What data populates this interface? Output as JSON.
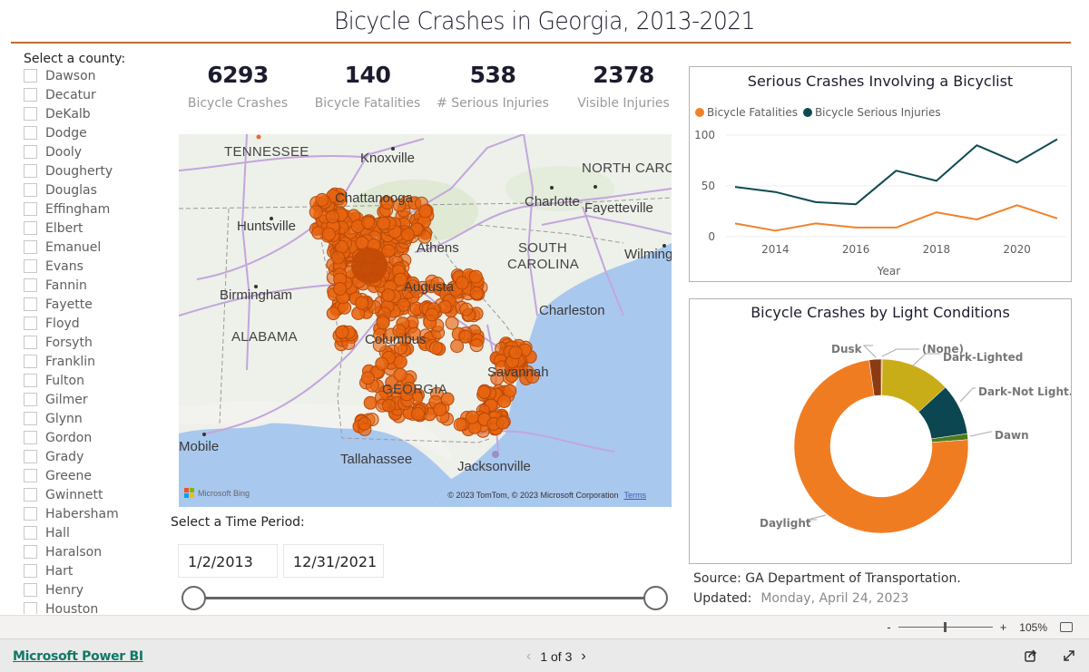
{
  "report": {
    "title": "Bicycle Crashes in Georgia, 2013-2021",
    "accent_color": "#c26a35"
  },
  "county_slicer": {
    "label": "Select a county:",
    "items": [
      "Dawson",
      "Decatur",
      "DeKalb",
      "Dodge",
      "Dooly",
      "Dougherty",
      "Douglas",
      "Effingham",
      "Elbert",
      "Emanuel",
      "Evans",
      "Fannin",
      "Fayette",
      "Floyd",
      "Forsyth",
      "Franklin",
      "Fulton",
      "Gilmer",
      "Glynn",
      "Gordon",
      "Grady",
      "Greene",
      "Gwinnett",
      "Habersham",
      "Hall",
      "Haralson",
      "Hart",
      "Henry",
      "Houston"
    ]
  },
  "kpis": [
    {
      "value": "6293",
      "label": "Bicycle Crashes"
    },
    {
      "value": "140",
      "label": "Bicycle Fatalities"
    },
    {
      "value": "538",
      "label": "# Serious Injuries"
    },
    {
      "value": "2378",
      "label": "Visible Injuries"
    }
  ],
  "map": {
    "labels": {
      "tennessee": "TENNESSEE",
      "knoxville": "Knoxville",
      "north_carolina": "NORTH CAROLINA",
      "chattanooga": "Chattanooga",
      "charlotte": "Charlotte",
      "fayetteville": "Fayetteville",
      "huntsville": "Huntsville",
      "athens": "Athens",
      "south_carolina_1": "SOUTH",
      "south_carolina_2": "CAROLINA",
      "wilmington": "Wilmington",
      "birmingham": "Birmingham",
      "augusta": "Augusta",
      "charleston": "Charleston",
      "alabama": "ALABAMA",
      "columbus": "Columbus",
      "savannah": "Savannah",
      "georgia": "GEORGIA",
      "mobile": "Mobile",
      "tallahassee": "Tallahassee",
      "jacksonville": "Jacksonville"
    },
    "bing_label": "Microsoft Bing",
    "attribution": "© 2023 TomTom, © 2023 Microsoft Corporation",
    "terms_label": "Terms",
    "marker_color": "#e8640f"
  },
  "time_slicer": {
    "label": "Select a Time Period:",
    "start": "1/2/2013",
    "end": "12/31/2021"
  },
  "chart_data": [
    {
      "type": "line",
      "title": "Serious Crashes Involving a Bicyclist",
      "xlabel": "Year",
      "ylabel": "",
      "x": [
        2013,
        2014,
        2015,
        2016,
        2017,
        2018,
        2019,
        2020,
        2021
      ],
      "x_ticks": [
        "2014",
        "2016",
        "2018",
        "2020"
      ],
      "y_ticks": [
        "0",
        "50",
        "100"
      ],
      "ylim": [
        0,
        100
      ],
      "grid": true,
      "legend": "top-left",
      "series": [
        {
          "name": "Bicycle Fatalities",
          "color": "#f0822a",
          "values": [
            13,
            6,
            13,
            9,
            9,
            24,
            17,
            31,
            18
          ]
        },
        {
          "name": "Bicycle Serious Injuries",
          "color": "#0f4a52",
          "values": [
            49,
            44,
            34,
            32,
            65,
            55,
            90,
            73,
            96
          ]
        }
      ]
    },
    {
      "type": "pie",
      "subtype": "donut",
      "title": "Bicycle Crashes by Light Conditions",
      "categories": [
        "(None)",
        "Dark-Lighted",
        "Dark-Not Lighted",
        "Dawn",
        "Daylight",
        "Dusk"
      ],
      "display_labels": [
        "(None)",
        "Dark-Lighted",
        "Dark-Not Light...",
        "Dawn",
        "Daylight",
        "Dusk"
      ],
      "values": [
        0.2,
        13.0,
        9.5,
        1.1,
        74.0,
        2.2
      ],
      "unit": "percent (estimated)",
      "colors": [
        "#7a7a7a",
        "#c9ad18",
        "#0c4650",
        "#4f7a1c",
        "#f07c22",
        "#8b3a11"
      ]
    }
  ],
  "source": {
    "text": "Source: GA Department of Transportation.",
    "updated_label": "Updated:",
    "updated_value": "Monday, April 24, 2023"
  },
  "zoom_bar": {
    "minus": "-",
    "plus": "+",
    "level": "105%"
  },
  "footer": {
    "brand_link": "Microsoft Power BI",
    "page_indicator": "1 of 3",
    "prev": "‹",
    "next": "›"
  }
}
